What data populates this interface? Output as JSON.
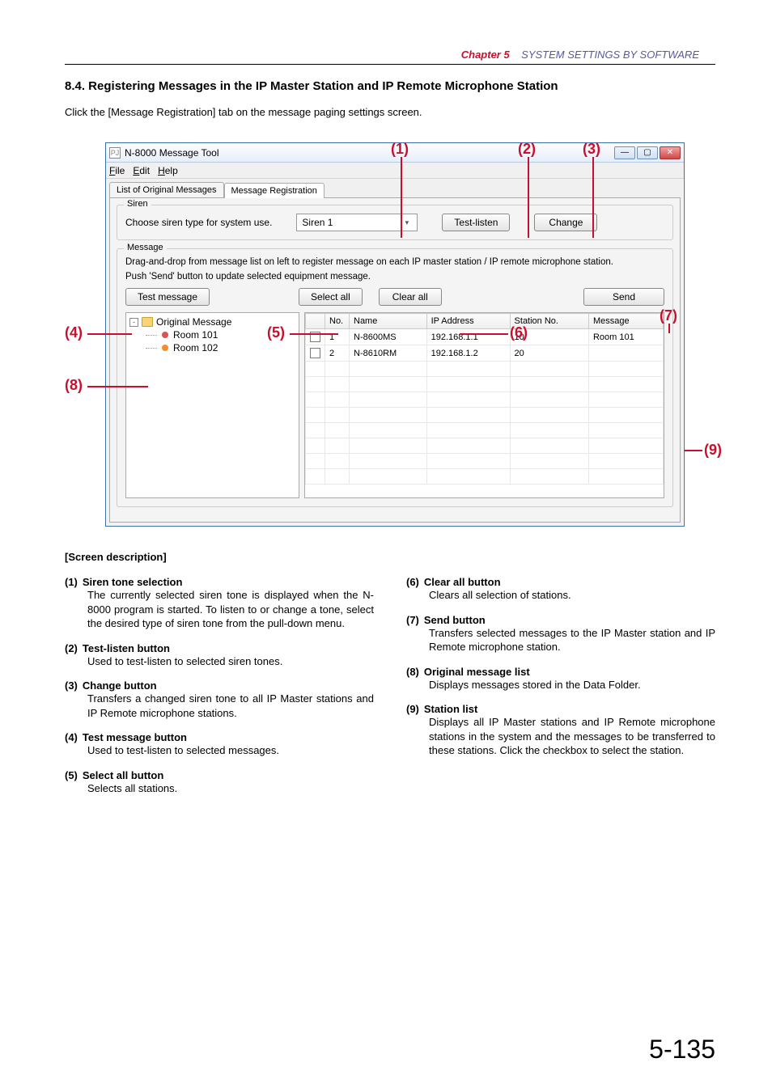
{
  "header": {
    "chapter": "Chapter 5",
    "chapter_title": "SYSTEM SETTINGS BY SOFTWARE"
  },
  "section_title": "8.4. Registering Messages in the IP Master Station and IP Remote Microphone Station",
  "intro": "Click the [Message Registration] tab on the message paging settings screen.",
  "callouts": {
    "c1": "(1)",
    "c2": "(2)",
    "c3": "(3)",
    "c4": "(4)",
    "c5": "(5)",
    "c6": "(6)",
    "c7": "(7)",
    "c8": "(8)",
    "c9": "(9)"
  },
  "window": {
    "title": "N-8000 Message Tool",
    "menus": {
      "file": "File",
      "edit": "Edit",
      "help": "Help"
    },
    "tabs": {
      "list": "List of Original Messages",
      "reg": "Message Registration"
    },
    "siren": {
      "legend": "Siren",
      "label": "Choose siren type for system use.",
      "selected": "Siren 1",
      "test_listen": "Test-listen",
      "change": "Change"
    },
    "message": {
      "legend": "Message",
      "line1": "Drag-and-drop from message list on left to register message on each IP master station / IP remote microphone station.",
      "line2": "Push 'Send' button to update selected equipment message.",
      "test_msg": "Test message",
      "select_all": "Select all",
      "clear_all": "Clear all",
      "send": "Send"
    },
    "tree": {
      "root": "Original Message",
      "child1": "Room 101",
      "child2": "Room 102"
    },
    "table": {
      "headers": {
        "chk": "",
        "no": "No.",
        "name": "Name",
        "ip": "IP Address",
        "station": "Station No.",
        "msg": "Message"
      },
      "rows": [
        {
          "no": "1",
          "name": "N-8600MS",
          "ip": "192.168.1.1",
          "station": "10",
          "msg": "Room 101"
        },
        {
          "no": "2",
          "name": "N-8610RM",
          "ip": "192.168.1.2",
          "station": "20",
          "msg": ""
        }
      ]
    }
  },
  "desc": {
    "heading": "[Screen description]",
    "i1": {
      "num": "(1)",
      "title": "Siren tone selection",
      "body": "The currently selected siren tone is displayed when the N-8000 program is started. To listen to or change a tone, select the desired type of siren tone from the pull-down menu."
    },
    "i2": {
      "num": "(2)",
      "title": "Test-listen button",
      "body": "Used to test-listen to selected siren tones."
    },
    "i3": {
      "num": "(3)",
      "title": "Change button",
      "body": "Transfers a changed siren tone to all IP Master stations and IP Remote microphone stations."
    },
    "i4": {
      "num": "(4)",
      "title": "Test message button",
      "body": "Used to test-listen to selected messages."
    },
    "i5": {
      "num": "(5)",
      "title": "Select all button",
      "body": "Selects all stations."
    },
    "i6": {
      "num": "(6)",
      "title": "Clear all button",
      "body": "Clears all selection of stations."
    },
    "i7": {
      "num": "(7)",
      "title": "Send button",
      "body": "Transfers selected messages to the IP Master station and IP Remote microphone station."
    },
    "i8": {
      "num": "(8)",
      "title": "Original message list",
      "body": "Displays messages stored in the Data Folder."
    },
    "i9": {
      "num": "(9)",
      "title": "Station list",
      "body": "Displays all IP Master stations and IP Remote microphone stations in the system and the messages to be transferred to these stations. Click the checkbox to select the station."
    }
  },
  "page_number": "5-135"
}
